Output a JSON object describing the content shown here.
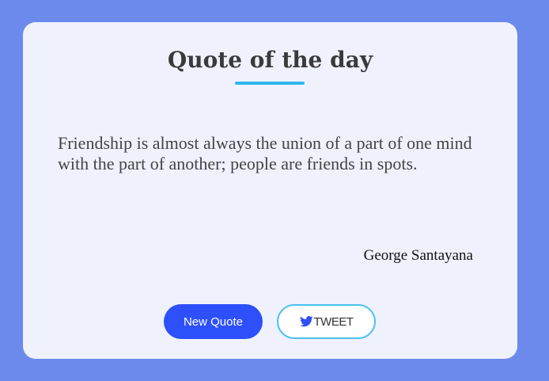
{
  "card": {
    "title": "Quote of the day",
    "quote": "Friendship is almost always the union of a part of one mind with the part of another; people are friends in spots.",
    "author": "George Santayana"
  },
  "actions": {
    "new_quote_label": "New Quote",
    "tweet_label": "TWEET"
  },
  "icons": {
    "tweet": "twitter-bird-icon"
  },
  "colors": {
    "background": "#6c8aec",
    "card": "#eff2fd",
    "accent": "#2fb8f0",
    "primary_button": "#2e50fb",
    "twitter_blue": "#2e50fb"
  }
}
